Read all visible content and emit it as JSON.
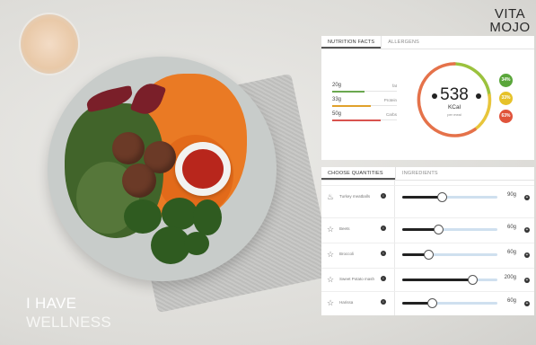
{
  "brand": {
    "line1": "VITA",
    "line2": "MOJO"
  },
  "tagline": {
    "line1": "I HAVE",
    "line2": "WELLNESS"
  },
  "nutrition_panel": {
    "tabs": [
      {
        "label": "NUTRITION FACTS",
        "active": true
      },
      {
        "label": "ALLERGENS",
        "active": false
      }
    ],
    "macros": [
      {
        "value": "20g",
        "name": "fat",
        "color": "#6aa84f",
        "fraction": 0.5
      },
      {
        "value": "33g",
        "name": "Protein",
        "color": "#e0a12b",
        "fraction": 0.6
      },
      {
        "value": "50g",
        "name": "Carbs",
        "color": "#d9534f",
        "fraction": 0.75
      }
    ],
    "kcal": {
      "value": "538",
      "unit": "KCal",
      "sub": "per meal"
    },
    "percentages": [
      {
        "label": "34%",
        "color": "#5aa63a"
      },
      {
        "label": "33%",
        "color": "#e6c229"
      },
      {
        "label": "63%",
        "color": "#e0533a"
      }
    ]
  },
  "quantities_panel": {
    "tabs": [
      {
        "label": "CHOOSE QUANTITIES",
        "active": true
      },
      {
        "label": "INGREDIENTS",
        "active": false
      }
    ],
    "rows": [
      {
        "name": "Turkey meatballs",
        "amount": "90g",
        "fraction": 0.42,
        "icon": "meatball-icon"
      },
      {
        "name": "Beets",
        "amount": "60g",
        "fraction": 0.38,
        "icon": "star-icon"
      },
      {
        "name": "Broccoli",
        "amount": "60g",
        "fraction": 0.28,
        "icon": "star-icon"
      },
      {
        "name": "Sweet Potato mash",
        "amount": "200g",
        "fraction": 0.74,
        "icon": "star-icon"
      },
      {
        "name": "Harissa",
        "amount": "60g",
        "fraction": 0.32,
        "icon": "star-icon"
      }
    ]
  }
}
